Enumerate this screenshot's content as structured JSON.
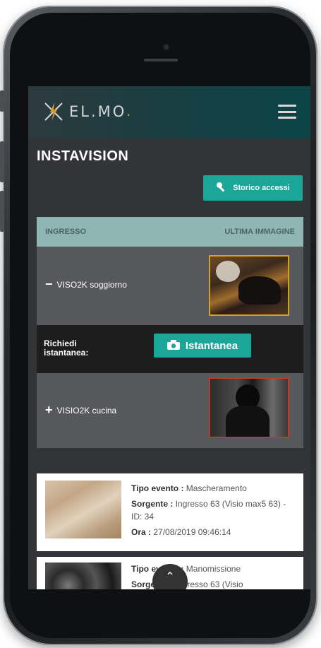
{
  "brand": {
    "logo_text": "EL.MO",
    "logo_dot": ".",
    "accent": "#1aa79a"
  },
  "page": {
    "title": "INSTAVISION"
  },
  "actions": {
    "history_label": "Storico accessi",
    "snapshot_label": "Istantanea",
    "request_label": "Richiedi istantanea:"
  },
  "table": {
    "headers": [
      "INGRESSO",
      "ULTIMA IMMAGINE"
    ],
    "rows": [
      {
        "sign": "−",
        "label": "VISO2K soggiorno"
      },
      {
        "sign": "+",
        "label": "VISIO2K cucina"
      }
    ]
  },
  "events": [
    {
      "tipo_label": "Tipo evento :",
      "tipo_value": " Mascheramento",
      "sorgente_label": "Sorgente :",
      "sorgente_value": " Ingresso 63 (Visio max5 63) - ID: 34",
      "ora_label": "Ora :",
      "ora_value": " 27/08/2019 09:46:14"
    },
    {
      "tipo_label": "Tipo evento :",
      "tipo_value": " Manomissione",
      "sorgente_label": "Sorgente :",
      "sorgente_value": " Ingresso 63 (Visio"
    }
  ],
  "icons": {
    "menu": "hamburger-icon",
    "history": "key-icon",
    "snapshot": "camera-icon",
    "scroll_up": "chevron-up-icon"
  }
}
